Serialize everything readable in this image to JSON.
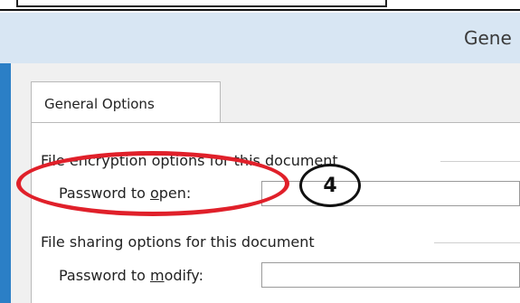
{
  "window": {
    "title": "Gene"
  },
  "tabs": [
    {
      "label": "General Options",
      "selected": true
    }
  ],
  "encryption": {
    "group_label": "File encryption options for this document",
    "password_open_pre": "Password to ",
    "password_open_access": "o",
    "password_open_post": "pen:",
    "password_open_value": ""
  },
  "sharing": {
    "group_label": "File sharing options for this document",
    "password_modify_pre": "Password to ",
    "password_modify_access": "m",
    "password_modify_post": "odify:",
    "password_modify_value": ""
  },
  "annotations": {
    "step_number": "4",
    "highlight_color": "#e0202a"
  }
}
